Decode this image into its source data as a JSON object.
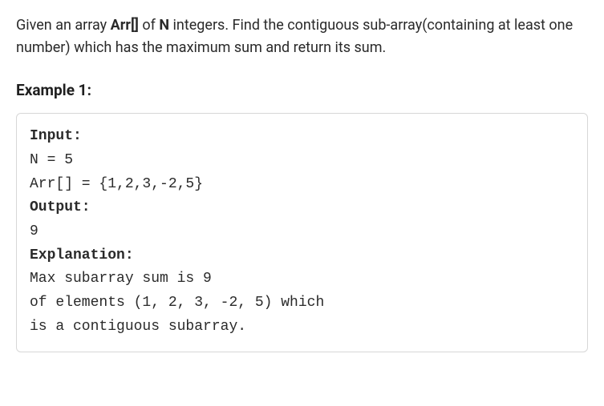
{
  "problem": {
    "pre_text": "Given an array ",
    "bold1": "Arr[]",
    "mid_text": " of ",
    "bold2": "N",
    "post_text": " integers. Find the contiguous sub-array(containing at least one number) which has the maximum sum and return its sum."
  },
  "example": {
    "heading": "Example 1:",
    "input_label": "Input:",
    "n_line": "N = 5",
    "arr_line": "Arr[] = {1,2,3,-2,5}",
    "output_label": "Output:",
    "output_value": "9",
    "explanation_label": "Explanation:",
    "expl_line1": "Max subarray sum is 9",
    "expl_line2": "of elements (1, 2, 3, -2, 5) which ",
    "expl_line3": "is a contiguous subarray."
  }
}
